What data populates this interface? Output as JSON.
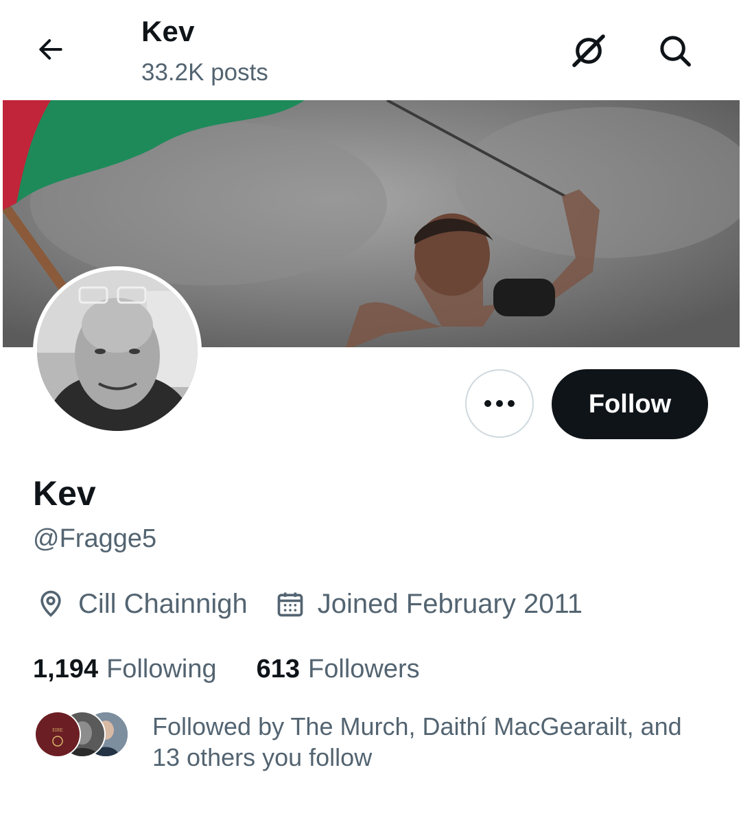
{
  "header": {
    "title": "Kev",
    "posts_count": "33.2K posts",
    "back_icon": "arrow-left-icon",
    "grok_icon": "grok-icon",
    "search_icon": "search-icon"
  },
  "banner": {
    "description_icon": "banner-image",
    "flag_colors": [
      "#c0253a",
      "#1e8a5a",
      "#e8e8e8"
    ]
  },
  "profile": {
    "display_name": "Kev",
    "handle": "@Fragge5",
    "location": "Cill Chainnigh",
    "joined": "Joined February 2011",
    "following_count": "1,194",
    "following_label": "Following",
    "followers_count": "613",
    "followers_label": "Followers"
  },
  "actions": {
    "more_icon": "more-horizontal-icon",
    "follow_label": "Follow"
  },
  "followed_by": {
    "text": "Followed by The Murch, Daithí MacGearailt, and 13 others you follow"
  },
  "colors": {
    "primary_text": "#0f1419",
    "secondary_text": "#536471",
    "follow_bg": "#0f1419",
    "border": "#cfd9de"
  }
}
